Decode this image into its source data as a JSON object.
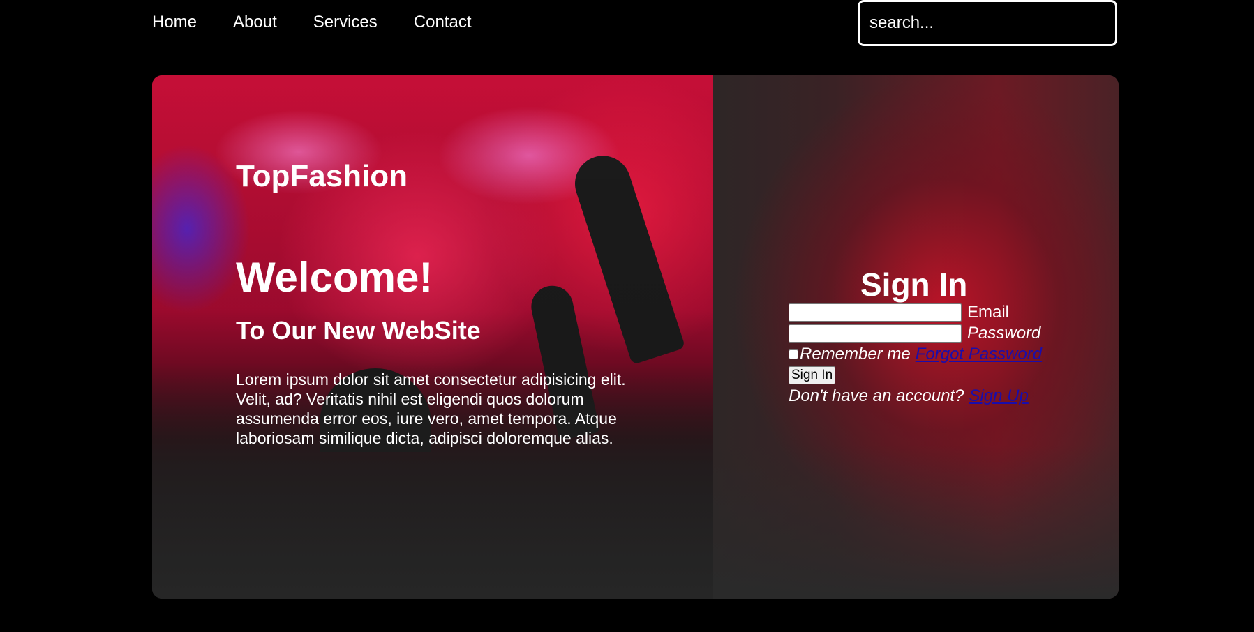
{
  "nav": {
    "links": [
      "Home",
      "About",
      "Services",
      "Contact"
    ],
    "search_placeholder": "search..."
  },
  "hero": {
    "brand": "TopFashion",
    "welcome": "Welcome!",
    "subhead": "To Our New WebSite",
    "body": "Lorem ipsum dolor sit amet consectetur adipisicing elit. Velit, ad? Veritatis nihil est eligendi quos dolorum assumenda error eos, iure vero, amet tempora. Atque laboriosam similique dicta, adipisci doloremque alias."
  },
  "login": {
    "title": "Sign In",
    "email_label": "Email",
    "password_label": "Password",
    "remember_label": "Remember me",
    "forgot_link": "Forgot Password",
    "submit_label": "Sign In",
    "no_account_text": "Don't have an account?",
    "signup_link": "Sign Up"
  },
  "colors": {
    "background": "#000000",
    "accent_red": "#c8102e",
    "link": "#1a0dab"
  }
}
